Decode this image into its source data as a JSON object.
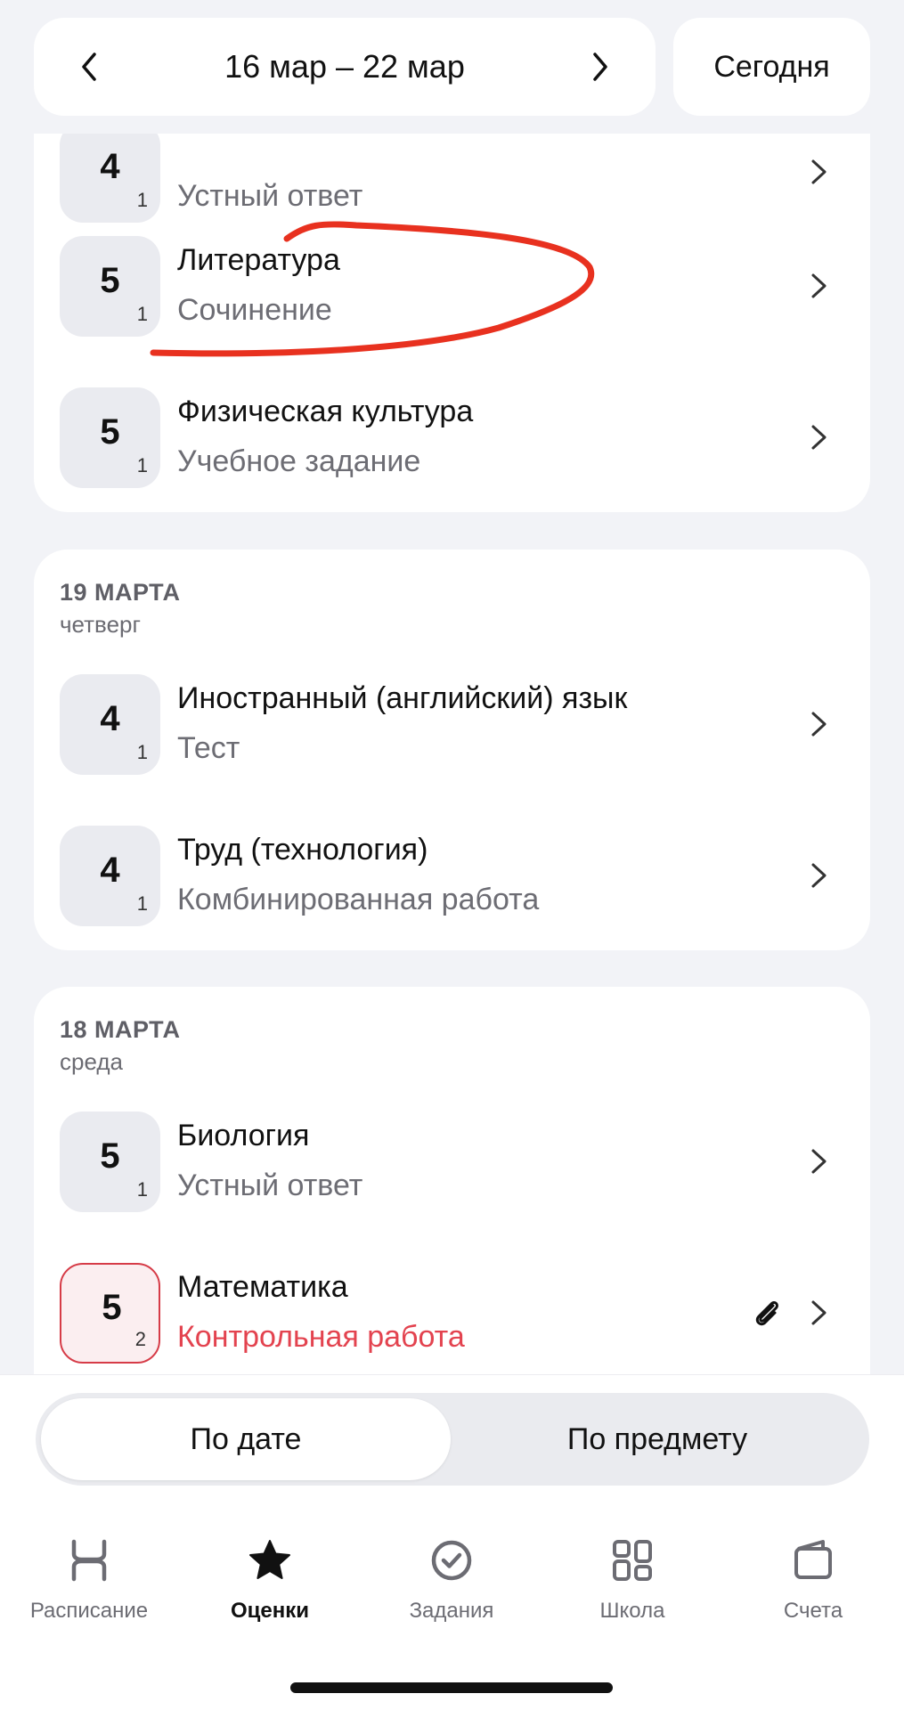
{
  "header": {
    "date_range": "16 мар – 22 мар",
    "today_button": "Сегодня"
  },
  "cards": [
    {
      "items": [
        {
          "grade": "4",
          "weight": "1",
          "subject": "",
          "work": "Устный ответ"
        },
        {
          "grade": "5",
          "weight": "1",
          "subject": "Литература",
          "work": "Сочинение"
        },
        {
          "grade": "5",
          "weight": "1",
          "subject": "Физическая культура",
          "work": "Учебное задание"
        }
      ]
    },
    {
      "date": "19 МАРТА",
      "weekday": "четверг",
      "items": [
        {
          "grade": "4",
          "weight": "1",
          "subject": "Иностранный (английский) язык",
          "work": "Тест"
        },
        {
          "grade": "4",
          "weight": "1",
          "subject": "Труд (технология)",
          "work": "Комбинированная работа"
        }
      ]
    },
    {
      "date": "18 МАРТА",
      "weekday": "среда",
      "items": [
        {
          "grade": "5",
          "weight": "1",
          "subject": "Биология",
          "work": "Устный ответ"
        },
        {
          "grade": "5",
          "weight": "2",
          "subject": "Математика",
          "work": "Контрольная работа",
          "has_attachment": true
        }
      ]
    }
  ],
  "segment": {
    "options": [
      "По дате",
      "По предмету"
    ],
    "selected": "По дате"
  },
  "tabs": [
    {
      "label": "Расписание",
      "icon": "schedule-icon"
    },
    {
      "label": "Оценки",
      "icon": "star-icon",
      "active": true
    },
    {
      "label": "Задания",
      "icon": "check-circle-icon"
    },
    {
      "label": "Школа",
      "icon": "grid-icon"
    },
    {
      "label": "Счета",
      "icon": "wallet-icon"
    }
  ],
  "colors": {
    "background": "#f2f3f7",
    "accent_red": "#e3434f",
    "annotation_red": "#e8311f"
  }
}
